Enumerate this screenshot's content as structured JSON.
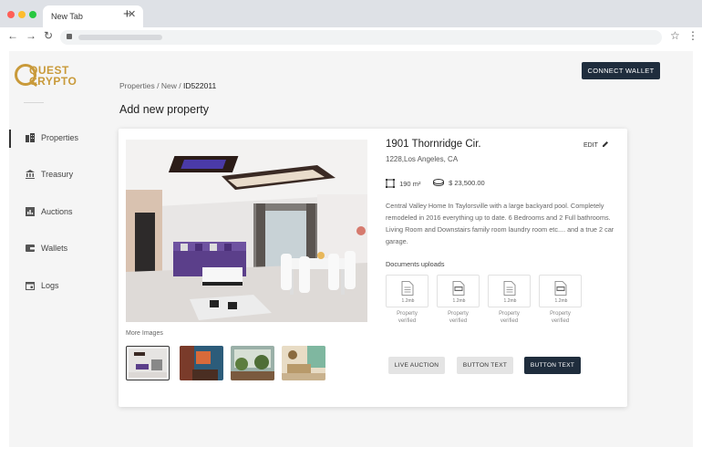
{
  "browser": {
    "tab_title": "New Tab",
    "tab_close": "✕",
    "new_tab": "+",
    "back": "←",
    "forward": "→",
    "reload": "↻",
    "bookmark": "☆",
    "menu": "⋮"
  },
  "logo": {
    "line1": "QUEST",
    "line2": "CRYPTO",
    "color": "#c99a3a"
  },
  "sidebar": {
    "items": [
      {
        "label": "Properties",
        "icon": "building-icon",
        "active": true
      },
      {
        "label": "Treasury",
        "icon": "bank-icon"
      },
      {
        "label": "Auctions",
        "icon": "chart-icon"
      },
      {
        "label": "Wallets",
        "icon": "wallet-icon"
      },
      {
        "label": "Logs",
        "icon": "calendar-icon"
      }
    ]
  },
  "header": {
    "connect_wallet": "CONNECT WALLET"
  },
  "breadcrumb": {
    "part1": "Properties",
    "sep1": " / ",
    "part2": "New",
    "sep2": " / ",
    "current": "ID522011"
  },
  "page_title": "Add new property",
  "property": {
    "title": "1901 Thornridge Cir.",
    "address": "1228,Los Angeles, CA",
    "edit_label": "EDIT",
    "area": "190 m²",
    "price": "$ 23,500.00",
    "description": "Central Valley Home In Taylorsville with a large backyard pool. Completely remodeled in 2016 everything up to date. 6 Bedrooms and 2 Full bathrooms. Living Room and Downstairs family room laundry room etc.... and a true 2 car garage."
  },
  "more_images_label": "More Images",
  "documents": {
    "label": "Documents uploads",
    "items": [
      {
        "size": "1.2mb",
        "caption_line1": "Property",
        "caption_line2": "verified",
        "type": "doc"
      },
      {
        "size": "1.2mb",
        "caption_line1": "Property",
        "caption_line2": "verified",
        "type": "zip"
      },
      {
        "size": "1.2mb",
        "caption_line1": "Property",
        "caption_line2": "verified",
        "type": "doc"
      },
      {
        "size": "1.2mb",
        "caption_line1": "Property",
        "caption_line2": "verified",
        "type": "zip"
      }
    ]
  },
  "actions": {
    "live_auction": "LIVE AUCTION",
    "button_text_1": "BUTTON TEXT",
    "button_text_2": "BUTTON TEXT"
  },
  "colors": {
    "primary_dark": "#1f2d3d",
    "gold": "#c99a3a",
    "purple_sofa": "#5b3f8a"
  }
}
